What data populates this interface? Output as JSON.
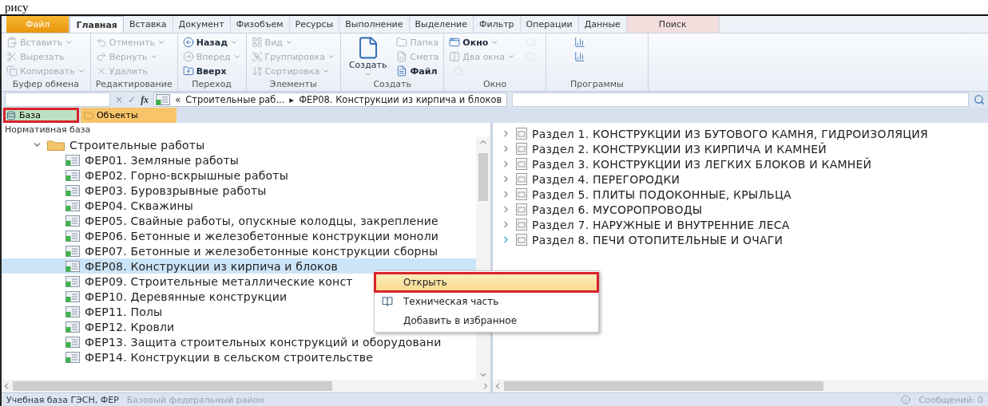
{
  "caption_fragment": "рису",
  "ribbon_tabs": [
    {
      "label": "Файл",
      "kind": "file",
      "selected": false
    },
    {
      "label": "Главная",
      "kind": "tab",
      "selected": true
    },
    {
      "label": "Вставка",
      "kind": "tab",
      "selected": false
    },
    {
      "label": "Документ",
      "kind": "tab",
      "selected": false
    },
    {
      "label": "Физобъем",
      "kind": "tab",
      "selected": false
    },
    {
      "label": "Ресурсы",
      "kind": "tab",
      "selected": false
    },
    {
      "label": "Выполнение",
      "kind": "tab",
      "selected": false
    },
    {
      "label": "Выделение",
      "kind": "tab",
      "selected": false
    },
    {
      "label": "Фильтр",
      "kind": "tab",
      "selected": false
    },
    {
      "label": "Операции",
      "kind": "tab",
      "selected": false
    },
    {
      "label": "Данные",
      "kind": "tab",
      "selected": false
    },
    {
      "label": "Поиск",
      "kind": "search",
      "selected": false
    }
  ],
  "ribbon_groups": [
    {
      "label": "Буфер обмена",
      "items": [
        {
          "kind": "small",
          "label": "Вставить",
          "disabled": true,
          "dropdown": true
        },
        {
          "kind": "small",
          "label": "Вырезать",
          "disabled": true,
          "dropdown": false
        },
        {
          "kind": "small",
          "label": "Копировать",
          "disabled": true,
          "dropdown": true
        }
      ]
    },
    {
      "label": "Редактирование",
      "items": [
        {
          "kind": "small",
          "label": "Отменить",
          "disabled": true,
          "dropdown": true
        },
        {
          "kind": "small",
          "label": "Вернуть",
          "disabled": true,
          "dropdown": true
        },
        {
          "kind": "small",
          "label": "Удалить",
          "disabled": true,
          "dropdown": false
        }
      ]
    },
    {
      "label": "Переход",
      "items": [
        {
          "kind": "small",
          "label": "Назад",
          "disabled": false,
          "dropdown": true
        },
        {
          "kind": "small",
          "label": "Вперед",
          "disabled": true,
          "dropdown": true
        },
        {
          "kind": "small",
          "label": "Вверх",
          "disabled": false,
          "dropdown": false
        }
      ]
    },
    {
      "label": "Элементы",
      "items": [
        {
          "kind": "small",
          "label": "Вид",
          "disabled": true,
          "dropdown": true
        },
        {
          "kind": "small",
          "label": "Группировка",
          "disabled": true,
          "dropdown": true
        },
        {
          "kind": "small",
          "label": "Сортировка",
          "disabled": true,
          "dropdown": true
        }
      ]
    },
    {
      "label": "Создать",
      "items": [
        {
          "kind": "large",
          "label": "Создать",
          "disabled": false,
          "dropdown": true
        },
        {
          "kind": "small",
          "label": "Папка",
          "disabled": true,
          "dropdown": false
        },
        {
          "kind": "small",
          "label": "Смета",
          "disabled": true,
          "dropdown": false
        },
        {
          "kind": "small",
          "label": "Файл",
          "disabled": false,
          "dropdown": false
        }
      ]
    },
    {
      "label": "Окно",
      "items": [
        {
          "kind": "small",
          "label": "Окно",
          "disabled": false,
          "dropdown": true
        },
        {
          "kind": "small",
          "label": "Два окна",
          "disabled": true,
          "dropdown": true
        },
        {
          "kind": "icon",
          "disabled": true
        },
        {
          "kind": "icon",
          "disabled": true
        },
        {
          "kind": "icon",
          "disabled": true
        }
      ]
    },
    {
      "label": "Программы",
      "items": [
        {
          "kind": "icon",
          "disabled": false
        },
        {
          "kind": "icon",
          "disabled": false
        }
      ]
    }
  ],
  "formula_bar": {
    "cancel": "×",
    "confirm": "✓",
    "fx": "fx",
    "back": "«",
    "path": [
      "Строительные раб...",
      "ФЕР08. Конструкции из кирпича и блоков"
    ],
    "separator": "▸"
  },
  "panel_tabs": [
    {
      "label": "База",
      "selected": true,
      "annotated": true
    },
    {
      "label": "Объекты",
      "selected": false,
      "annotated": false
    }
  ],
  "tree": {
    "header": "Нормативная база",
    "root": {
      "label": "Строительные работы",
      "expanded": true,
      "children": [
        {
          "label": "ФЕР01. Земляные работы",
          "selected": false
        },
        {
          "label": "ФЕР02. Горно-вскрышные работы",
          "selected": false
        },
        {
          "label": "ФЕР03. Буровзрывные работы",
          "selected": false
        },
        {
          "label": "ФЕР04. Скважины",
          "selected": false
        },
        {
          "label": "ФЕР05. Свайные работы, опускные колодцы, закрепление",
          "selected": false
        },
        {
          "label": "ФЕР06. Бетонные и железобетонные конструкции моноли",
          "selected": false
        },
        {
          "label": "ФЕР07. Бетонные и железобетонные конструкции сборны",
          "selected": false
        },
        {
          "label": "ФЕР08. Конструкции из кирпича и блоков",
          "selected": true
        },
        {
          "label": "ФЕР09. Строительные металлические конст",
          "selected": false
        },
        {
          "label": "ФЕР10. Деревянные конструкции",
          "selected": false
        },
        {
          "label": "ФЕР11. Полы",
          "selected": false
        },
        {
          "label": "ФЕР12. Кровли",
          "selected": false
        },
        {
          "label": "ФЕР13. Защита строительных конструкций и оборудовани",
          "selected": false
        },
        {
          "label": "ФЕР14. Конструкции в сельском строительстве",
          "selected": false
        }
      ]
    }
  },
  "context_menu": [
    {
      "label": "Открыть",
      "kind": "plain",
      "selected": true,
      "annotated": true
    },
    {
      "label": "Техническая часть",
      "kind": "with-icon",
      "selected": false,
      "annotated": false
    },
    {
      "label": "Добавить в избранное",
      "kind": "plain",
      "selected": false,
      "annotated": false
    }
  ],
  "sections": [
    {
      "label": "Раздел 1. КОНСТРУКЦИИ ИЗ БУТОВОГО КАМНЯ, ГИДРОИЗОЛЯЦИЯ",
      "highlighted": false
    },
    {
      "label": "Раздел 2. КОНСТРУКЦИИ ИЗ КИРПИЧА И КАМНЕЙ",
      "highlighted": false
    },
    {
      "label": "Раздел 3. КОНСТРУКЦИИ ИЗ ЛЕГКИХ БЛОКОВ И КАМНЕЙ",
      "highlighted": false
    },
    {
      "label": "Раздел 4. ПЕРЕГОРОДКИ",
      "highlighted": false
    },
    {
      "label": "Раздел 5. ПЛИТЫ ПОДОКОННЫЕ, КРЫЛЬЦА",
      "highlighted": false
    },
    {
      "label": "Раздел 6. МУСОРОПРОВОДЫ",
      "highlighted": false
    },
    {
      "label": "Раздел 7. НАРУЖНЫЕ И ВНУТРЕННИЕ ЛЕСА",
      "highlighted": false
    },
    {
      "label": "Раздел 8. ПЕЧИ ОТОПИТЕЛЬНЫЕ И ОЧАГИ",
      "highlighted": true
    }
  ],
  "status_bar": {
    "base": "Учебная база ГЭСН, ФЕР",
    "region": "Базовый федеральный район",
    "messages": "Сообщений: 0"
  }
}
